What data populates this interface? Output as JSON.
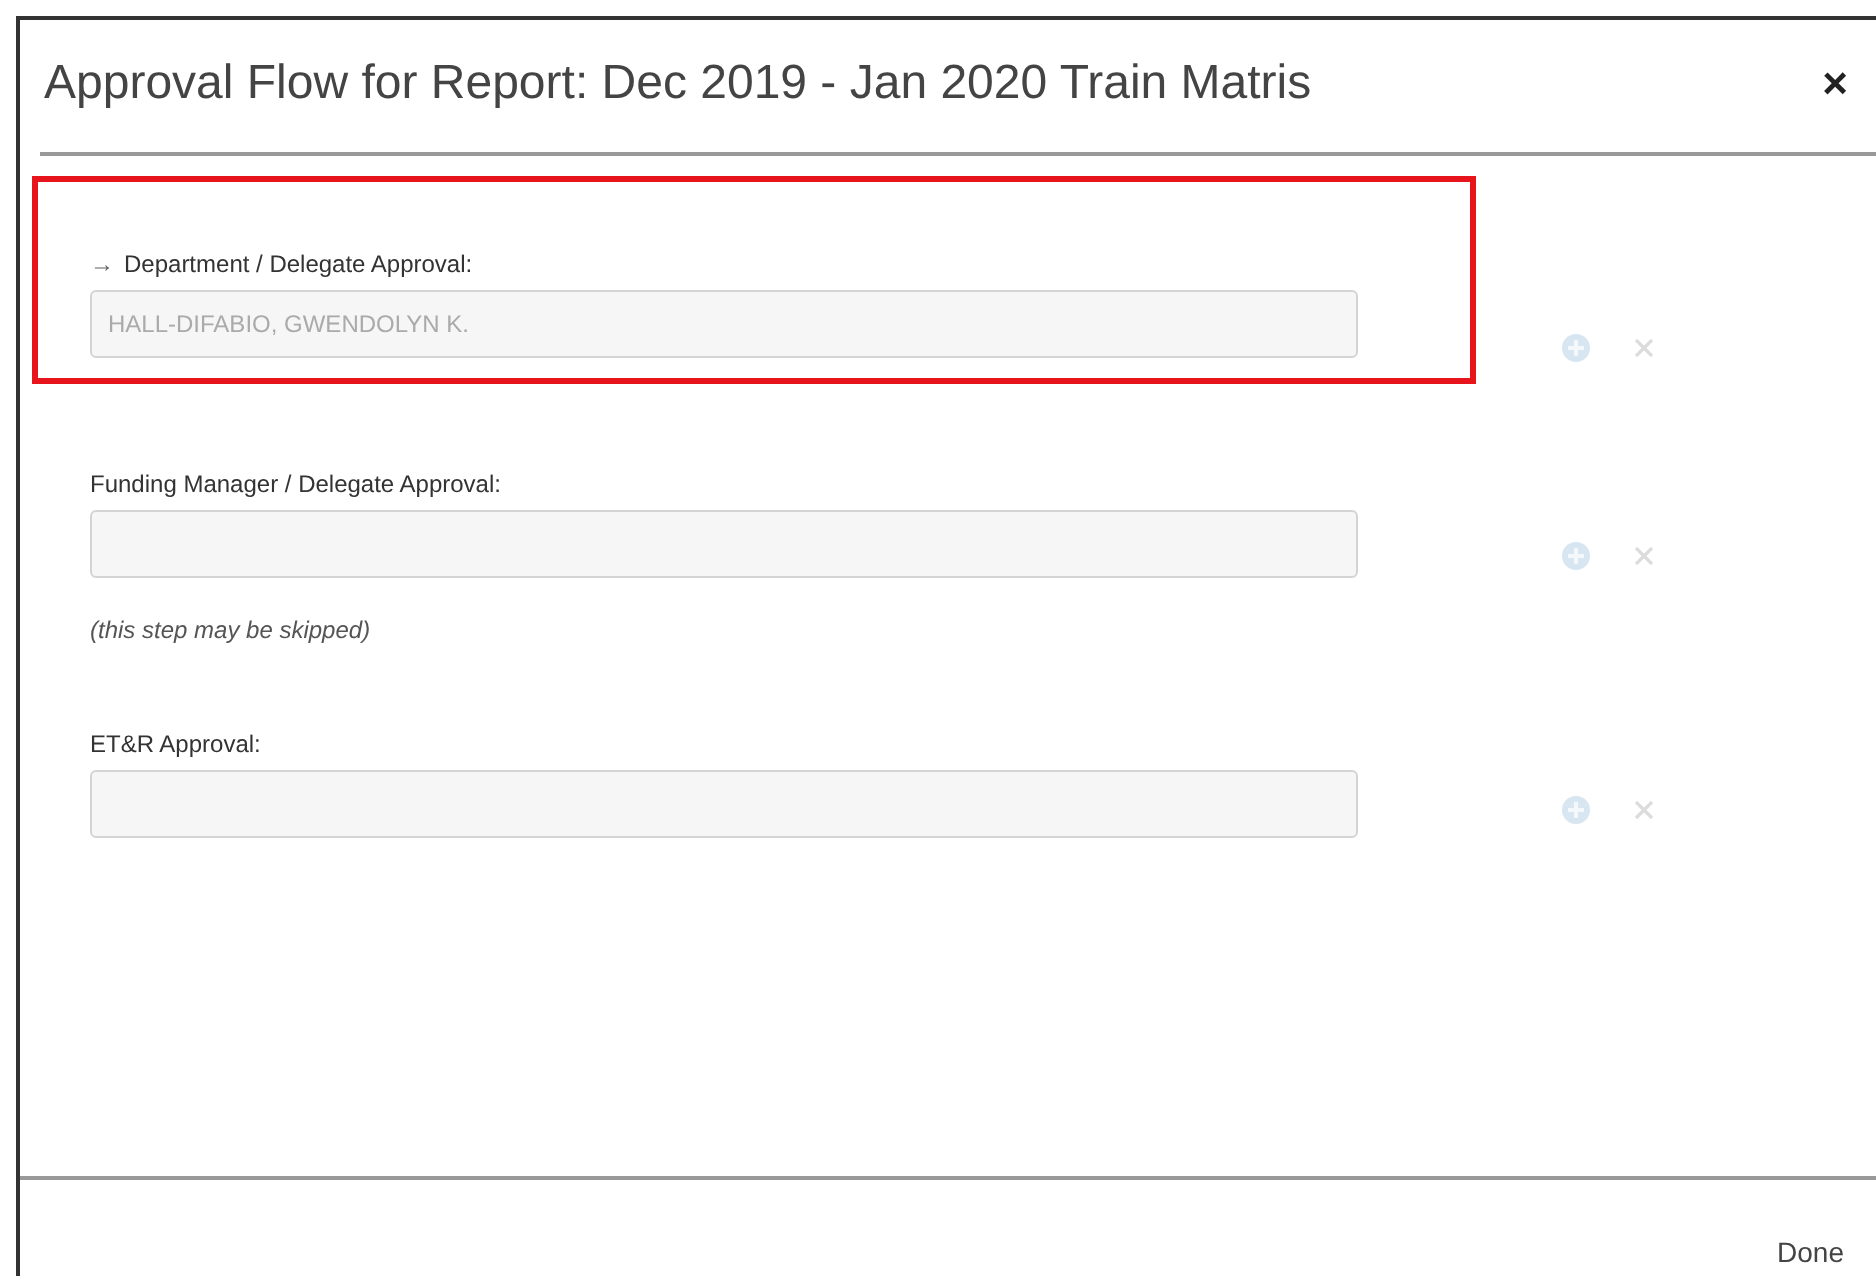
{
  "dialog": {
    "title": "Approval Flow for Report: Dec 2019 - Jan 2020 Train Matris",
    "close": "×"
  },
  "steps": [
    {
      "marker": "→",
      "label": "Department / Delegate Approval:",
      "value": "HALL-DIFABIO, GWENDOLYN K.",
      "highlighted": true
    },
    {
      "label": "Funding Manager / Delegate Approval:",
      "note": "(this step may be skipped)",
      "highlighted": false
    },
    {
      "label": "ET&R Approval:",
      "highlighted": false
    }
  ],
  "footer": {
    "button": "Done"
  }
}
